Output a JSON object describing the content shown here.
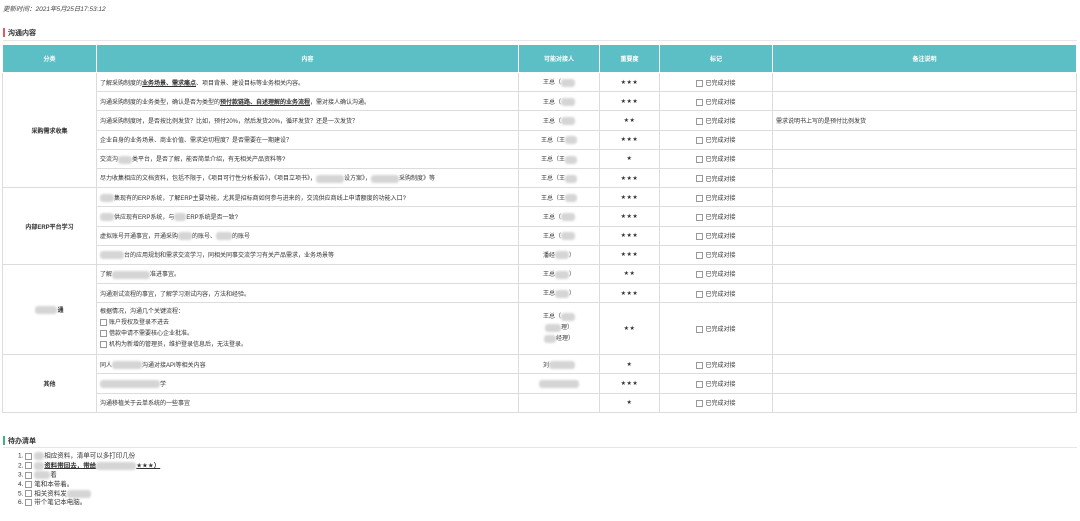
{
  "update_time": "更新时间：2021年5月25日17:53:12",
  "section1_title": "沟通内容",
  "section2_title": "待办清单",
  "headers": {
    "category": "分类",
    "content": "内容",
    "contact": "可能对接人",
    "importance": "重要度",
    "mark": "标记",
    "remark": "备注说明"
  },
  "done_label": "已完成对接",
  "categories": {
    "c1": "采购需求收集",
    "c2": "内部ERP平台学习",
    "c3": "通",
    "c4": "其他"
  },
  "rows": [
    {
      "content_a": "了解采购制度的",
      "u1": "业务场景、需求痛点",
      "content_b": "、项目背景、建设目标等业务相关内容。",
      "contact": "王总（",
      "stars": "★★★"
    },
    {
      "content_a": "沟通采购制度的业务类型，确认是否为类型的",
      "u1": "预付款链路、自述理解的业务流程",
      "content_b": "，需对接人确认沟通。",
      "contact": "王总（",
      "stars": "★★★"
    },
    {
      "content_a": "沟通采购制度时，是否按比例发货？比如，预付20%，然后发货20%，循环发货？还是一次发货？",
      "contact": "王总（",
      "stars": "★★",
      "remark": "需求说明书上写的是预付比例发货"
    },
    {
      "content_a": "企业自身的业务场景、商业价值、需求迫切程度？是否需要在一期建设？",
      "contact": "王总（王",
      "stars": "★★★"
    },
    {
      "content_a": "交流沟",
      "content_b": "类平台，是否了解，能否简单介绍，有无相关产品资料等?",
      "contact": "王总（王",
      "stars": "★"
    },
    {
      "content_a": "尽力收集相应的文档资料，包括不限于，《项目可行性分析报告》，《项目立项书》，",
      "content_b": "设方案》，",
      "content_c": "采购制度》等",
      "contact": "王总（王",
      "stars": "★★★"
    },
    {
      "content_a": "",
      "content_b": "集现有的ERP系统，了解ERP主要功能，尤其是招标商如何参与进来的，交流供应商线上申请额度的功能入口?",
      "contact": "王总（王",
      "stars": "★★★"
    },
    {
      "content_a": "",
      "content_b": "供应现有ERP系统，与",
      "content_c": "ERP系统是否一致?",
      "contact": "王总（",
      "stars": "★★★"
    },
    {
      "content_a": "虚拟账号开通事宜，开通采购",
      "content_b": "的账号、",
      "content_c": "的账号",
      "contact": "王总（",
      "stars": "★★★"
    },
    {
      "content_a": "",
      "content_b": "台的应用规划和需求交流学习，同相关同事交流学习有关产品需求，业务场景等",
      "contact": "潘经",
      "contact_b": "）",
      "stars": "★★★"
    },
    {
      "content_a": "了解",
      "content_b": "准进事宜。",
      "contact": "王总",
      "contact_b": "）",
      "stars": "★★"
    },
    {
      "content_a": "沟通测试流程的事宜，了解学习测试内容，方法和经验。",
      "contact": "王总",
      "contact_b": "）",
      "stars": "★★★"
    },
    {
      "content_a": "根据情况，沟通几个关键流程：",
      "check1": "账户授权及登录不进去",
      "check2": "借款申请不需要核心企业批准。",
      "check3": "机构为新增的管理员，维护登录信息后，无法登录。",
      "contact": "王总（",
      "contact_b": "理）",
      "contact_c": "经理）",
      "stars": "★★"
    },
    {
      "content_a": "同人",
      "content_b": "沟通对接API等相关内容",
      "contact": "刘",
      "stars": "★"
    },
    {
      "content_a": "",
      "content_b": "学",
      "contact": "",
      "stars": "★★★"
    },
    {
      "content_a": "沟通移植关于云单系统的一些事宜",
      "contact": "",
      "stars": "★"
    }
  ],
  "todo": [
    {
      "num": "1.",
      "text": "相应资料，清单可以多打印几份"
    },
    {
      "num": "2.",
      "text": "资料带回去，带给",
      "text_b": "★★★）"
    },
    {
      "num": "3.",
      "text": "着"
    },
    {
      "num": "4.",
      "text": "笔和本带着。"
    },
    {
      "num": "5.",
      "text": "相关资料发"
    },
    {
      "num": "6.",
      "text": "带个笔记本电脑。"
    }
  ]
}
